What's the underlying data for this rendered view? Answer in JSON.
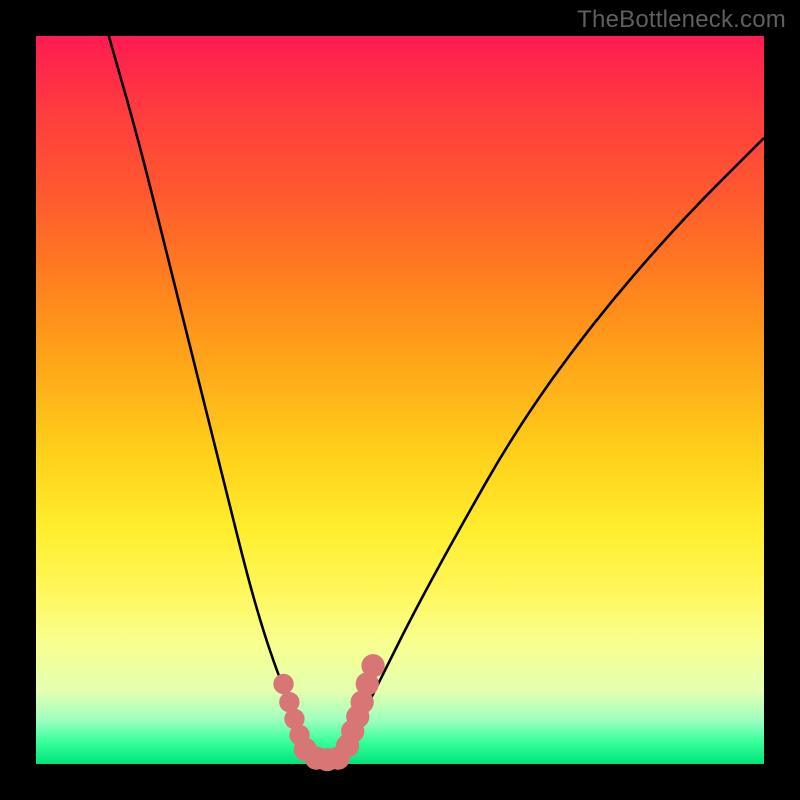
{
  "watermark": "TheBottleneck.com",
  "chart_data": {
    "type": "line",
    "title": "",
    "xlabel": "",
    "ylabel": "",
    "xlim": [
      0,
      100
    ],
    "ylim": [
      0,
      100
    ],
    "series": [
      {
        "name": "left-branch",
        "x": [
          10,
          14,
          18,
          22,
          26,
          29,
          31,
          33,
          35,
          36,
          37,
          38
        ],
        "y": [
          100,
          86,
          70,
          54,
          38,
          26,
          19,
          13,
          8,
          5,
          3,
          0
        ]
      },
      {
        "name": "right-branch",
        "x": [
          42,
          43,
          45,
          48,
          52,
          58,
          66,
          76,
          88,
          100
        ],
        "y": [
          0,
          3,
          7,
          13,
          21,
          32,
          46,
          60,
          74,
          86
        ]
      }
    ],
    "markers": [
      {
        "name": "left-dot-1",
        "x": 34.0,
        "y": 11.0,
        "r": 1.4
      },
      {
        "name": "left-dot-2",
        "x": 34.8,
        "y": 8.5,
        "r": 1.4
      },
      {
        "name": "left-dot-3",
        "x": 35.5,
        "y": 6.2,
        "r": 1.4
      },
      {
        "name": "left-dot-4",
        "x": 36.2,
        "y": 4.0,
        "r": 1.4
      },
      {
        "name": "left-dot-5",
        "x": 37.0,
        "y": 2.0,
        "r": 1.6
      },
      {
        "name": "mid-dot-1",
        "x": 38.5,
        "y": 0.8,
        "r": 1.6
      },
      {
        "name": "mid-dot-2",
        "x": 40.0,
        "y": 0.6,
        "r": 1.6
      },
      {
        "name": "mid-dot-3",
        "x": 41.5,
        "y": 0.8,
        "r": 1.6
      },
      {
        "name": "right-dot-1",
        "x": 42.8,
        "y": 2.5,
        "r": 1.6
      },
      {
        "name": "right-dot-2",
        "x": 43.5,
        "y": 4.5,
        "r": 1.6
      },
      {
        "name": "right-dot-3",
        "x": 44.2,
        "y": 6.5,
        "r": 1.6
      },
      {
        "name": "right-dot-4",
        "x": 44.8,
        "y": 8.5,
        "r": 1.6
      },
      {
        "name": "right-dot-5",
        "x": 45.5,
        "y": 11.0,
        "r": 1.6
      },
      {
        "name": "right-dot-6",
        "x": 46.3,
        "y": 13.5,
        "r": 1.6
      }
    ],
    "curve_color": "#000000",
    "marker_color": "#d87676"
  }
}
